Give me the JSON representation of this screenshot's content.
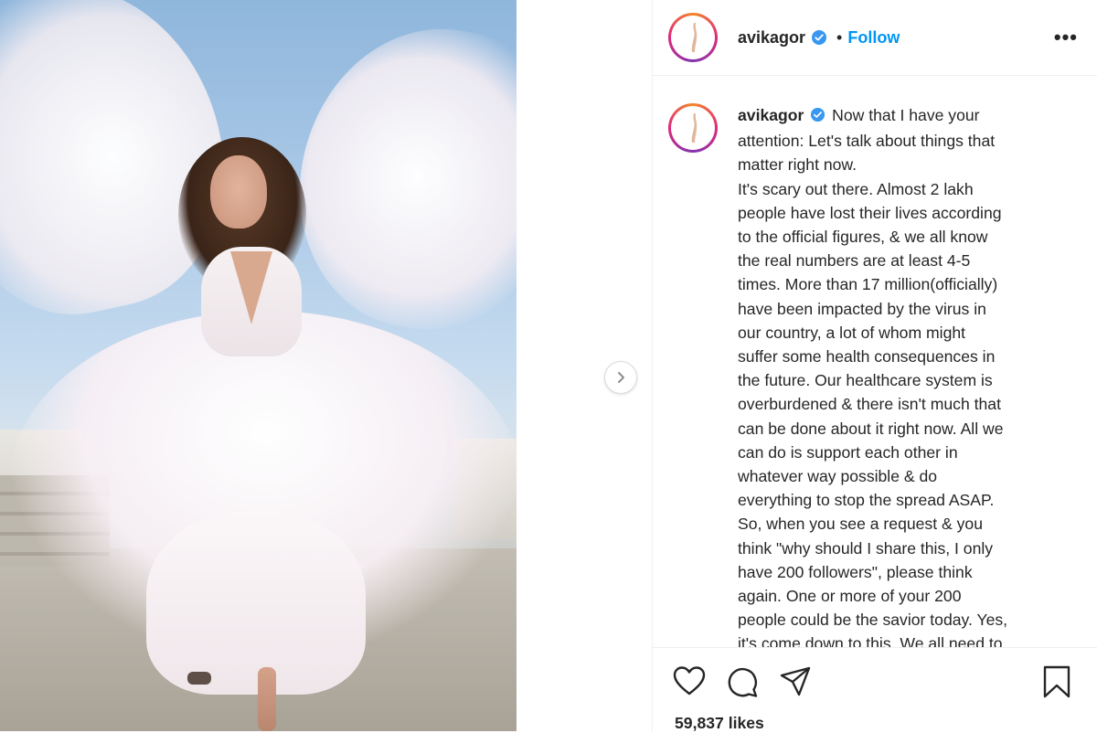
{
  "post": {
    "username": "avikagor",
    "separator": "•",
    "follow_label": "Follow",
    "more_label": "•••",
    "caption_lines": [
      "Now that I have your",
      "attention: Let's talk about things that",
      "matter right now.",
      "It's scary out there. Almost 2 lakh",
      "people have lost their lives according",
      "to the official figures, & we all know",
      "the real numbers are at least 4-5",
      "times. More than 17 million(officially)",
      "have been impacted by the virus in",
      "our country, a lot of whom might",
      "suffer some health consequences in",
      "the future. Our healthcare system is",
      "overburdened & there isn't much that",
      "can be done about it right now. All we",
      "can do is support each other in",
      "whatever way possible & do",
      "everything to stop the spread ASAP.",
      "So, when you see a request & you",
      "think \"why should I share this, I only",
      "have 200 followers\", please think",
      "again. One or more of your 200",
      "people could be the savior today. Yes,",
      "it's come down to this. We all need to"
    ],
    "likes": "59,837 likes"
  },
  "icons": {
    "like": "heart-icon",
    "comment": "comment-icon",
    "share": "send-icon",
    "save": "bookmark-icon",
    "verified": "verified-badge-icon",
    "next": "chevron-right-icon"
  },
  "colors": {
    "link": "#0095f6",
    "verified": "#3897f0",
    "text": "#262626"
  }
}
